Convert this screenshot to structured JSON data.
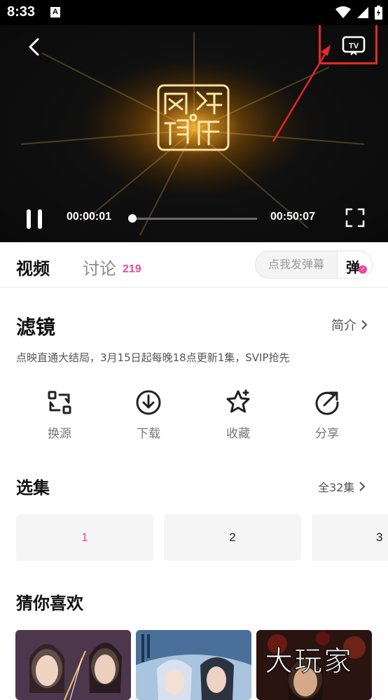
{
  "status_bar": {
    "time": "8:33",
    "notification_icon": "A"
  },
  "player": {
    "logo_chars": [
      "网",
      "络",
      "视",
      "听"
    ],
    "current_time": "00:00:01",
    "total_time": "00:50:07",
    "progress": 0.0003
  },
  "tabs": {
    "video": "视频",
    "discuss": "讨论",
    "discuss_count": "219",
    "danmaku_placeholder": "点我发弹幕",
    "danmaku_toggle": "弹"
  },
  "show": {
    "title": "滤镜",
    "intro_label": "简介",
    "description": "点映直通大结局，3月15日起每晚18点更新1集，SVIP抢先"
  },
  "actions": [
    {
      "label": "换源",
      "icon": "switch-source-icon"
    },
    {
      "label": "下载",
      "icon": "download-icon"
    },
    {
      "label": "收藏",
      "icon": "favorite-star-icon"
    },
    {
      "label": "分享",
      "icon": "share-icon"
    }
  ],
  "episodes": {
    "title": "选集",
    "all_label": "全32集",
    "items": [
      "1",
      "2",
      "3"
    ],
    "selected": "1"
  },
  "recommend": {
    "title": "猜你喜欢"
  },
  "colors": {
    "accent": "#f0489a",
    "highlight_box": "#e8262d"
  }
}
